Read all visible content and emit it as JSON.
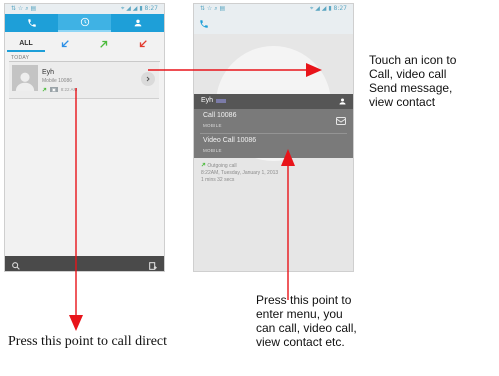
{
  "left_phone": {
    "status_left": "⇅ ☆ ⌕ ▤",
    "status_right": "⌖ ◢ ◢ ▮ 8:27",
    "tabs": [
      {
        "icon": "phone-icon"
      },
      {
        "icon": "clock-icon"
      },
      {
        "icon": "contacts-icon"
      }
    ],
    "filters": {
      "all_label": "ALL",
      "items": [
        {
          "icon": "incoming-call-icon",
          "color": "#2b8fe6"
        },
        {
          "icon": "outgoing-call-icon",
          "color": "#4cbb3c"
        },
        {
          "icon": "missed-call-icon",
          "color": "#e23a2d"
        }
      ]
    },
    "section_label": "TODAY",
    "call_entry": {
      "name": "Eyh",
      "subtitle": "Mobile 10086",
      "time": "8:22 AM"
    },
    "bottom_bar": {
      "icons": [
        "search-icon",
        "menu-icon"
      ]
    }
  },
  "right_phone": {
    "status_left": "⇅ ☆ ⌕ ▤",
    "status_right": "⌖ ◢ ◢ ▮ 8:27",
    "contact_name": "Eyh",
    "menu_items": [
      {
        "label": "Call 10086",
        "sub": "MOBILE"
      },
      {
        "label": "Video Call 10086",
        "sub": "MOBILE"
      }
    ],
    "call_info": {
      "type": "Outgoing call",
      "datetime": "8:22AM, Tuesday, January 1, 2013",
      "duration": "1 mins 32 secs"
    }
  },
  "annotations": {
    "icon_note": [
      "Touch an icon to",
      "Call, video call",
      "Send message,",
      "view contact"
    ],
    "menu_note": [
      "Press this point to",
      "enter menu, you",
      "can call, video call,",
      "view contact etc."
    ],
    "call_note": "Press this point to call direct"
  },
  "colors": {
    "arrow": "#e8141a",
    "accent": "#1e9fd8"
  }
}
